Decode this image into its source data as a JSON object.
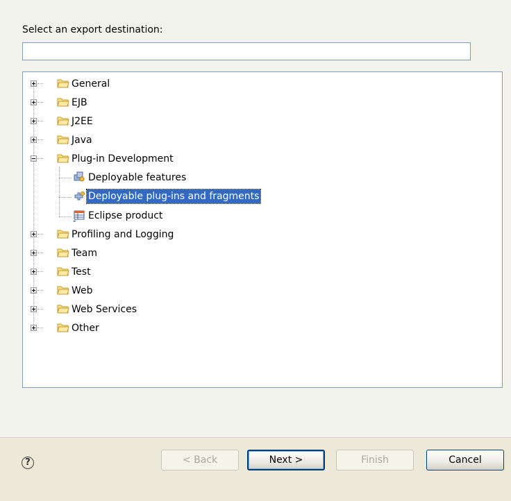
{
  "wizard": {
    "prompt": "Select an export destination:",
    "filter": {
      "value": "",
      "placeholder": ""
    }
  },
  "tree": {
    "categories": [
      {
        "label": "General"
      },
      {
        "label": "EJB"
      },
      {
        "label": "J2EE"
      },
      {
        "label": "Java"
      },
      {
        "label": "Plug-in Development",
        "expanded": true,
        "children": [
          {
            "label": "Deployable features",
            "icon": "features-icon"
          },
          {
            "label": "Deployable plug-ins and fragments",
            "icon": "plugin-icon",
            "selected": true
          },
          {
            "label": "Eclipse product",
            "icon": "product-icon"
          }
        ]
      },
      {
        "label": "Profiling and Logging"
      },
      {
        "label": "Team"
      },
      {
        "label": "Test"
      },
      {
        "label": "Web"
      },
      {
        "label": "Web Services"
      },
      {
        "label": "Other"
      }
    ]
  },
  "buttons": {
    "back": "< Back",
    "next": "Next >",
    "finish": "Finish",
    "cancel": "Cancel",
    "help": "?"
  }
}
